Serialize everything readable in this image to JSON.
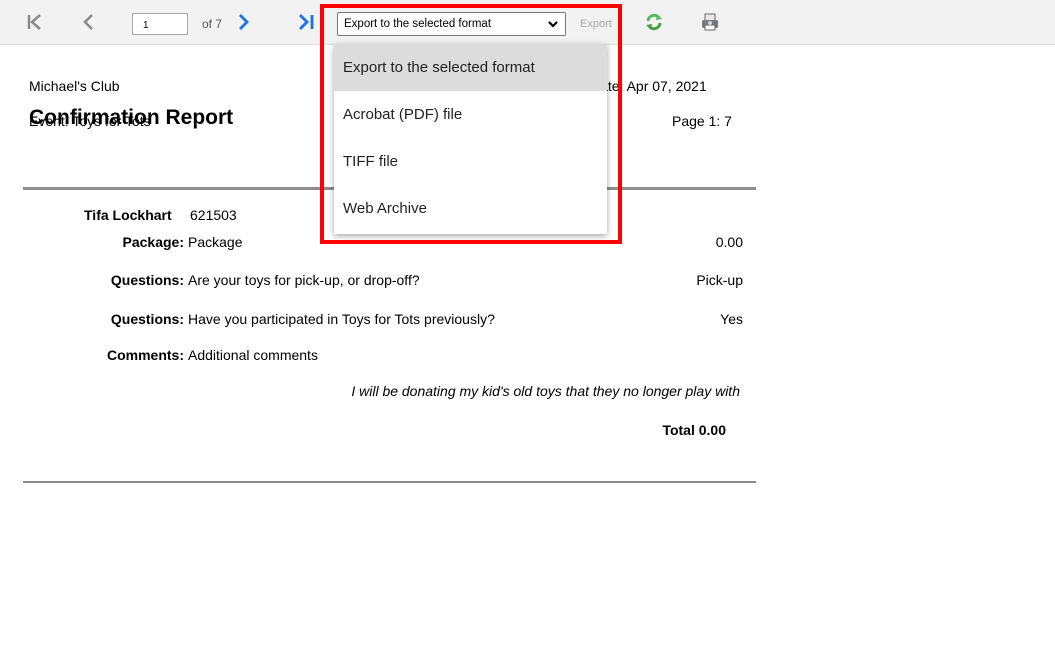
{
  "toolbar": {
    "page_value": "1",
    "of_text": "of 7",
    "export_select": {
      "selected": "Export to the selected format"
    },
    "export_button": "Export"
  },
  "dropdown": {
    "options": [
      "Export to the selected format",
      "Acrobat (PDF) file",
      "TIFF file",
      "Web Archive"
    ]
  },
  "report": {
    "club": "Michael's Club",
    "date": "Date: Apr 07, 2021",
    "event": "Event: Toys for Tots",
    "page": "Page 1: 7",
    "title": "Confirmation Report",
    "attendee": {
      "name": "Tifa Lockhart",
      "id": "621503"
    },
    "rows": [
      {
        "label": "Package:",
        "value": "Package",
        "amount": "0.00"
      },
      {
        "label": "Questions:",
        "value": "Are your toys for pick-up, or drop-off?",
        "amount": "Pick-up"
      },
      {
        "label": "Questions:",
        "value": "Have you participated in Toys for Tots previously?",
        "amount": "Yes"
      },
      {
        "label": "Comments:",
        "value": "Additional comments",
        "amount": ""
      }
    ],
    "comment": "I will be donating my kid's old toys that they no longer play with",
    "total": "Total 0.00"
  },
  "colors": {
    "highlight": "#ff0000",
    "nav_blue": "#1a73e8",
    "nav_gray": "#8a8a8a"
  },
  "icons": [
    "first-page-icon",
    "prev-page-icon",
    "next-page-icon",
    "last-page-icon",
    "refresh-icon",
    "print-icon"
  ]
}
